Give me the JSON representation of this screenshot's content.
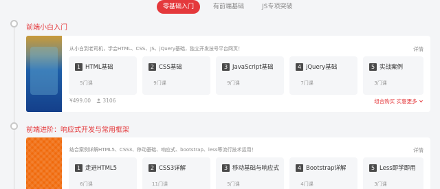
{
  "tabs": [
    {
      "label": "零基础入门",
      "active": true
    },
    {
      "label": "有前端基础",
      "active": false
    },
    {
      "label": "JS专项突破",
      "active": false
    }
  ],
  "sections": [
    {
      "title": "前端小白入门",
      "description": "从小白到老司机，学会HTML、CSS、JS、jQuery基础，独立开发技号平台网页！",
      "detail_label": "详情",
      "courses": [
        {
          "num": "1",
          "name": "HTML基础",
          "count": "5门课"
        },
        {
          "num": "2",
          "name": "CSS基础",
          "count": "9门课"
        },
        {
          "num": "3",
          "name": "JavaScript基础",
          "count": "9门课"
        },
        {
          "num": "4",
          "name": "jQuery基础",
          "count": "7门课"
        },
        {
          "num": "5",
          "name": "实战案例",
          "count": "3门课"
        }
      ],
      "price": "¥499.00",
      "learners": "3106",
      "buy_label": "组合购买 实惠更多"
    },
    {
      "title": "前端进阶：响应式开发与常用框架",
      "description": "结合案例详解HTML5、CSS3、移动基础、响应式、bootstrap、less等流行技术运用！",
      "detail_label": "详情",
      "courses": [
        {
          "num": "1",
          "name": "走进HTML5",
          "count": "6门课"
        },
        {
          "num": "2",
          "name": "CSS3详解",
          "count": "11门课"
        },
        {
          "num": "3",
          "name": "移动基础与响应式",
          "count": "5门课"
        },
        {
          "num": "4",
          "name": "Bootstrap详解",
          "count": "4门课"
        },
        {
          "num": "5",
          "name": "Less即学即用",
          "count": "3门课"
        }
      ]
    }
  ],
  "icons": {
    "learners": "person-icon",
    "buy": "chevron-down-icon"
  }
}
